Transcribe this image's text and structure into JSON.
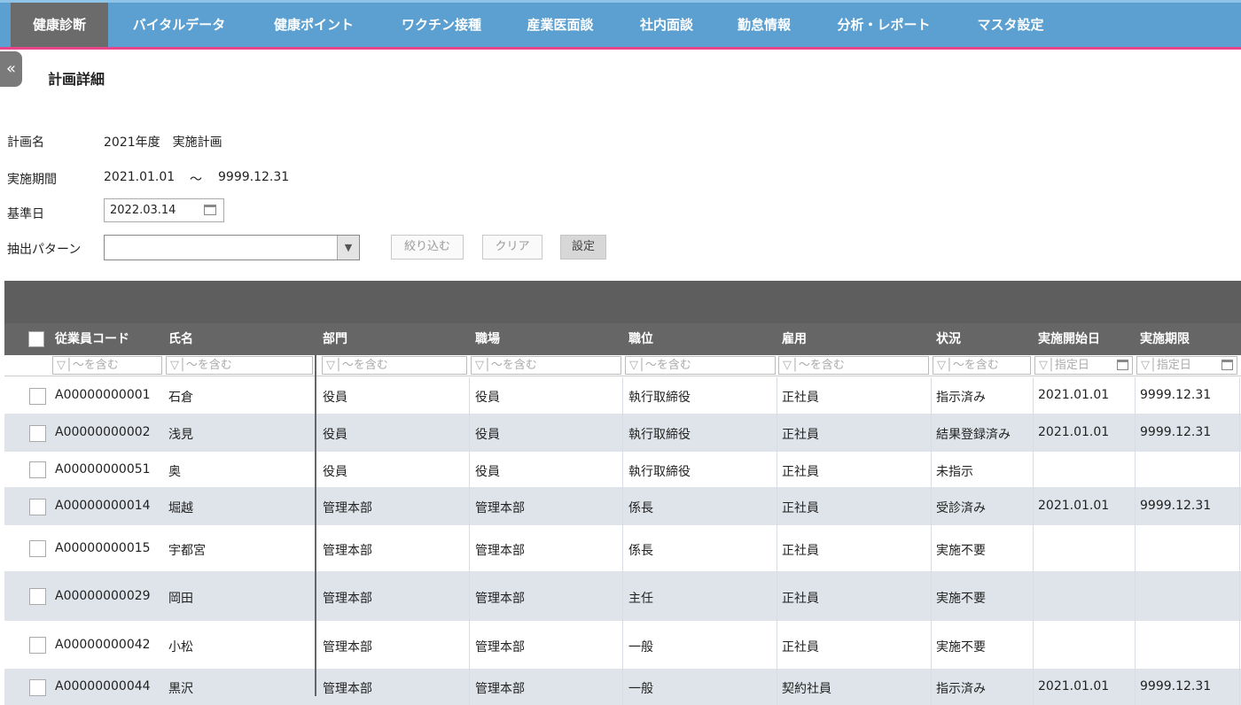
{
  "nav": {
    "items": [
      {
        "label": "健康診断",
        "active": true
      },
      {
        "label": "バイタルデータ",
        "active": false
      },
      {
        "label": "健康ポイント",
        "active": false
      },
      {
        "label": "ワクチン接種",
        "active": false
      },
      {
        "label": "産業医面談",
        "active": false
      },
      {
        "label": "社内面談",
        "active": false
      },
      {
        "label": "勤怠情報",
        "active": false
      },
      {
        "label": "分析・レポート",
        "active": false
      },
      {
        "label": "マスタ設定",
        "active": false
      }
    ],
    "accent_color": "#5ba0d0",
    "underline_color": "#e8468a"
  },
  "collapse_icon": "«",
  "page_title": "計画詳細",
  "form": {
    "plan_name_label": "計画名",
    "plan_name_value": "2021年度　実施計画",
    "period_label": "実施期間",
    "period_start": "2021.01.01",
    "period_sep": "～",
    "period_end": "9999.12.31",
    "base_date_label": "基準日",
    "base_date_value": "2022.03.14",
    "pattern_label": "抽出パターン",
    "pattern_value": "",
    "filter_button": "絞り込む",
    "clear_button": "クリア",
    "settings_button": "設定"
  },
  "grid": {
    "columns": [
      "従業員コード",
      "氏名",
      "部門",
      "職場",
      "職位",
      "雇用",
      "状況",
      "実施開始日",
      "実施期限"
    ],
    "filter_contains": "▽│～を含む",
    "filter_date": "▽│指定日",
    "rows": [
      {
        "code": "A00000000001",
        "name": "石倉",
        "dept": "役員",
        "workplace": "役員",
        "position": "執行取締役",
        "employment": "正社員",
        "status": "指示済み",
        "start": "2021.01.01",
        "deadline": "9999.12.31"
      },
      {
        "code": "A00000000002",
        "name": "浅見",
        "dept": "役員",
        "workplace": "役員",
        "position": "執行取締役",
        "employment": "正社員",
        "status": "結果登録済み",
        "start": "2021.01.01",
        "deadline": "9999.12.31"
      },
      {
        "code": "A00000000051",
        "name": "奥",
        "dept": "役員",
        "workplace": "役員",
        "position": "執行取締役",
        "employment": "正社員",
        "status": "未指示",
        "start": "",
        "deadline": ""
      },
      {
        "code": "A00000000014",
        "name": "堀越",
        "dept": "管理本部",
        "workplace": "管理本部",
        "position": "係長",
        "employment": "正社員",
        "status": "受診済み",
        "start": "2021.01.01",
        "deadline": "9999.12.31"
      },
      {
        "code": "A00000000015",
        "name": "宇都宮",
        "dept": "管理本部",
        "workplace": "管理本部",
        "position": "係長",
        "employment": "正社員",
        "status": "実施不要",
        "start": "",
        "deadline": ""
      },
      {
        "code": "A00000000029",
        "name": "岡田",
        "dept": "管理本部",
        "workplace": "管理本部",
        "position": "主任",
        "employment": "正社員",
        "status": "実施不要",
        "start": "",
        "deadline": ""
      },
      {
        "code": "A00000000042",
        "name": "小松",
        "dept": "管理本部",
        "workplace": "管理本部",
        "position": "一般",
        "employment": "正社員",
        "status": "実施不要",
        "start": "",
        "deadline": ""
      },
      {
        "code": "A00000000044",
        "name": "黒沢",
        "dept": "管理本部",
        "workplace": "管理本部",
        "position": "一般",
        "employment": "契約社員",
        "status": "指示済み",
        "start": "2021.01.01",
        "deadline": "9999.12.31"
      }
    ]
  }
}
